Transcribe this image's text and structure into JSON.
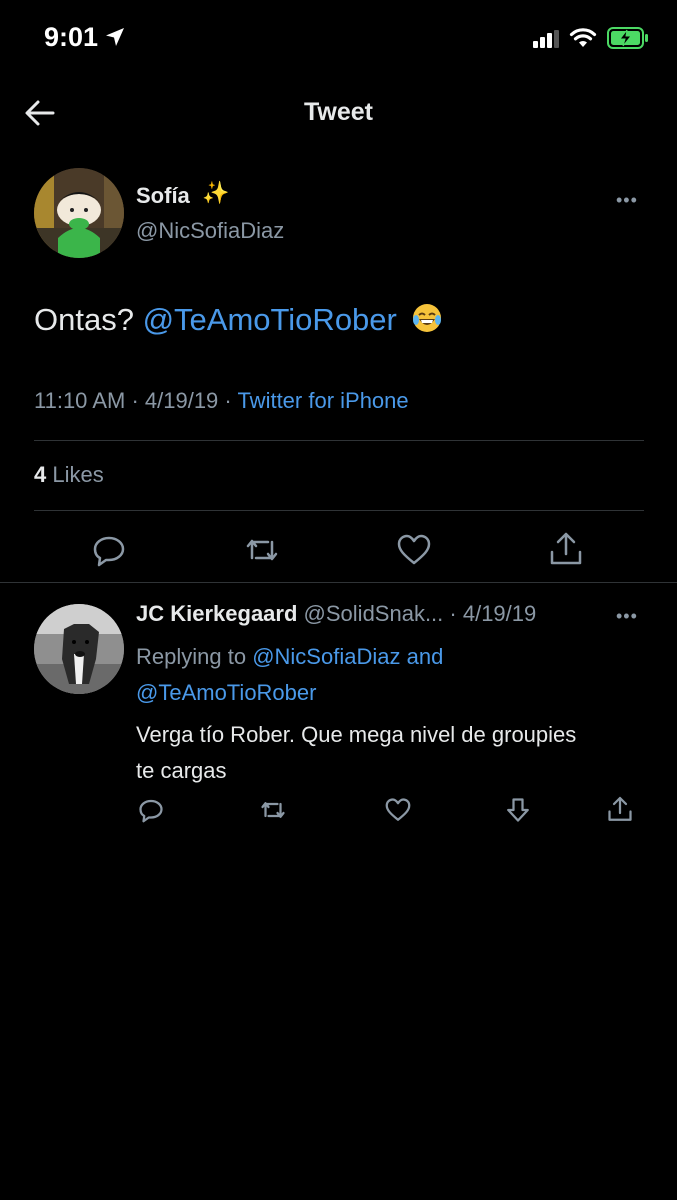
{
  "status_bar": {
    "time": "9:01"
  },
  "header": {
    "title": "Tweet",
    "back_icon": "back-arrow-icon"
  },
  "tweet": {
    "author_name": "Sofía",
    "author_emoji": "✨",
    "author_handle": "@NicSofiaDiaz",
    "text_prefix": "Ontas? ",
    "mention": "@TeAmoTioRober",
    "emoji": "😂",
    "time": "11:10 AM",
    "date": "4/19/19",
    "source": "Twitter for iPhone",
    "likes_count": "4",
    "likes_label": "Likes",
    "actions": [
      "reply-icon",
      "retweet-icon",
      "like-icon",
      "share-icon"
    ]
  },
  "reply": {
    "author_name": "JC Kierkegaard",
    "author_handle": "@SolidSnak...",
    "date": "4/19/19",
    "replying_prefix": "Replying to",
    "replying_mention_1": "@NicSofiaDiaz",
    "replying_and": "and",
    "replying_mention_2": "@TeAmoTioRober",
    "text": "Verga tío Rober. Que mega nivel de groupies te cargas",
    "actions": [
      "reply-icon",
      "retweet-icon",
      "like-icon",
      "downvote-icon",
      "share-icon"
    ]
  },
  "colors": {
    "background": "#000000",
    "accent": "#4a99e9",
    "secondary_text": "#8b98a5",
    "divider": "#2f3336"
  }
}
